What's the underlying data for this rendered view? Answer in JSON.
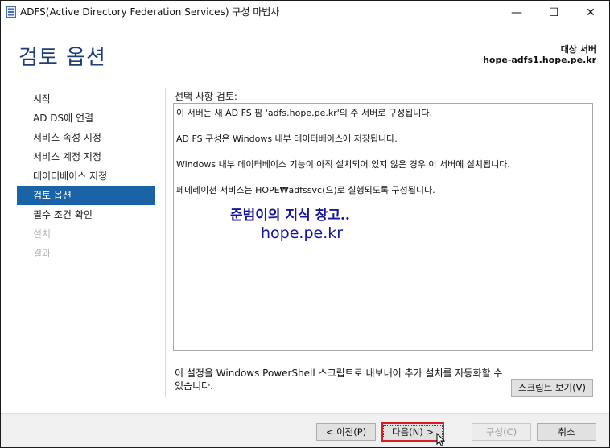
{
  "window": {
    "title": "ADFS(Active Directory Federation Services) 구성 마법사",
    "minimize_glyph": "—",
    "maximize_glyph": "☐",
    "close_glyph": "✕"
  },
  "header": {
    "page_title": "검토 옵션",
    "target_label": "대상 서버",
    "target_value": "hope-adfs1.hope.pe.kr"
  },
  "nav": {
    "items": [
      {
        "label": "시작",
        "state": "normal"
      },
      {
        "label": "AD DS에 연결",
        "state": "normal"
      },
      {
        "label": "서비스 속성 지정",
        "state": "normal"
      },
      {
        "label": "서비스 계정 지정",
        "state": "normal"
      },
      {
        "label": "데이터베이스 지정",
        "state": "normal"
      },
      {
        "label": "검토 옵션",
        "state": "active"
      },
      {
        "label": "필수 조건 확인",
        "state": "normal"
      },
      {
        "label": "설치",
        "state": "disabled"
      },
      {
        "label": "결과",
        "state": "disabled"
      }
    ]
  },
  "content": {
    "review_label": "선택 사항 검토:",
    "review_lines": [
      "이 서버는 새 AD FS 팜 'adfs.hope.pe.kr'의 주 서버로 구성됩니다.",
      "AD FS 구성은 Windows 내부 데이터베이스에 저장됩니다.",
      "Windows 내부 데이터베이스 기능이 아직 설치되어 있지 않은 경우 이 서버에 설치됩니다.",
      "페데레이션 서비스는 HOPE₩adfssvc(으)로 실행되도록 구성됩니다."
    ],
    "watermark_line1": "준범이의 지식 창고..",
    "watermark_line2": "hope.pe.kr",
    "powershell_text": "이 설정을 Windows PowerShell 스크립트로 내보내어 추가 설치를 자동화할 수 있습니다.",
    "view_script_button": "스크립트 보기(V)"
  },
  "footer": {
    "prev_button": "< 이전(P)",
    "next_button": "다음(N) >",
    "configure_button": "구성(C)",
    "cancel_button": "취소"
  },
  "colors": {
    "accent": "#1b63a7",
    "title_blue": "#1f3e78",
    "watermark": "#16169a",
    "focus_border": "#d61e2b"
  }
}
